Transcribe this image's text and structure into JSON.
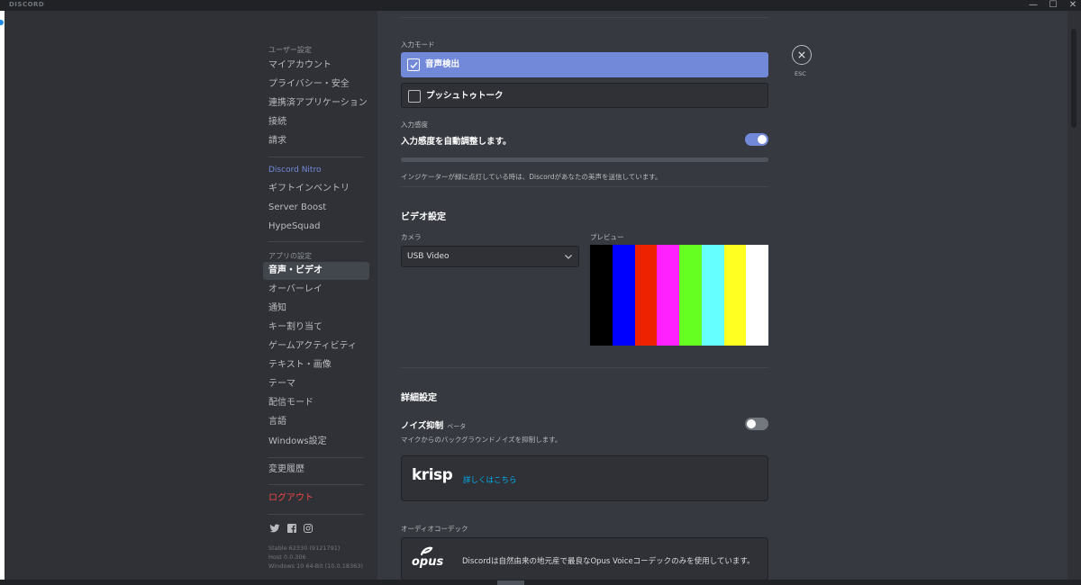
{
  "window": {
    "brand": "DISCORD",
    "controls": [
      "—",
      "☐",
      "✕"
    ]
  },
  "sidebar": {
    "user_header": "ユーザー設定",
    "user_items": [
      "マイアカウント",
      "プライバシー・安全",
      "連携済アプリケーション",
      "接続",
      "請求"
    ],
    "nitro_label": "Discord Nitro",
    "nitro_items": [
      "ギフトインベントリ",
      "Server Boost",
      "HypeSquad"
    ],
    "app_header": "アプリの設定",
    "app_items": [
      "音声・ビデオ",
      "オーバーレイ",
      "通知",
      "キー割り当て",
      "ゲームアクティビティ",
      "テキスト・画像",
      "テーマ",
      "配信モード",
      "言語",
      "Windows設定"
    ],
    "selected_item": "音声・ビデオ",
    "changelog": "変更履歴",
    "logout": "ログアウト",
    "social_icons": [
      "twitter-icon",
      "facebook-icon",
      "instagram-icon"
    ],
    "version_lines": [
      "Stable 62330 (9121791)",
      "Host 0.0.306",
      "Windows 10 64-Bit (10.0.18363)"
    ]
  },
  "voice": {
    "input_mode_label": "入力モード",
    "mode_voice_activity": "音声検出",
    "mode_push_to_talk": "プッシュトゥトーク",
    "selected_mode": "音声検出",
    "sensitivity_label": "入力感度",
    "auto_sensitivity_text": "入力感度を自動調整します。",
    "auto_sensitivity_enabled": true,
    "indicator_note": "インジケーターが緑に点灯している時は、Discordがあなたの美声を送信しています。"
  },
  "video": {
    "heading": "ビデオ設定",
    "camera_label": "カメラ",
    "camera_value": "USB Video",
    "preview_label": "プレビュー",
    "color_bars": [
      "#000000",
      "#0000ff",
      "#ee2200",
      "#ff22ff",
      "#66ff22",
      "#66ffff",
      "#ffff22",
      "#ffffff"
    ]
  },
  "advanced": {
    "heading": "詳細設定",
    "noise_title": "ノイズ抑制",
    "noise_badge": "ベータ",
    "noise_desc": "マイクからのバックグラウンドノイズを抑制します。",
    "noise_enabled": false,
    "krisp_logo": "krisp",
    "krisp_link": "詳しくはこちら",
    "codec_label": "オーディオコーデック",
    "opus_logo": "opus",
    "opus_desc": "Discordは自然由来の地元産で最良なOpus Voiceコーデックのみを使用しています。"
  },
  "close": {
    "label": "ESC"
  },
  "colors": {
    "accent": "#7289da",
    "danger": "#f04747",
    "link": "#00b0f4",
    "bg_content": "#36393f",
    "bg_sidebar": "#2f3136"
  }
}
